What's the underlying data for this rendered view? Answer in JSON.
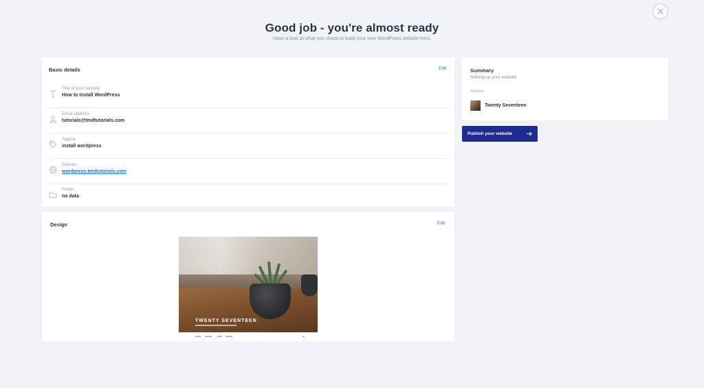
{
  "header": {
    "title": "Good job - you're almost ready",
    "subtitle": "Have a look at what you chose to build your new WordPress website from."
  },
  "basic_details": {
    "title": "Basic details",
    "edit_label": "Edit",
    "rows": [
      {
        "icon": "text-icon",
        "label": "Title of your website",
        "value": "How to Install WordPress"
      },
      {
        "icon": "user-icon",
        "label": "Email address",
        "value": "tutorials@tmdtutorials.com"
      },
      {
        "icon": "tag-icon",
        "label": "Tagline",
        "value": "install wordpress"
      },
      {
        "icon": "globe-icon",
        "label": "Domain",
        "value": "wordpress.tmdtutorials.com"
      },
      {
        "icon": "folder-icon",
        "label": "Folder",
        "value": "no data"
      }
    ]
  },
  "design": {
    "title": "Design",
    "edit_label": "Edit",
    "preview_title": "TWENTY SEVENTEEN"
  },
  "summary": {
    "title": "Summary",
    "subtitle": "Setting up your website",
    "themes_label": "Themes",
    "theme_name": "Twenty Seventeen"
  },
  "actions": {
    "publish_label": "Publish your website"
  },
  "colors": {
    "background": "#f1f3f8",
    "accent_link": "#2474d6",
    "publish_button": "#1e2b91"
  }
}
